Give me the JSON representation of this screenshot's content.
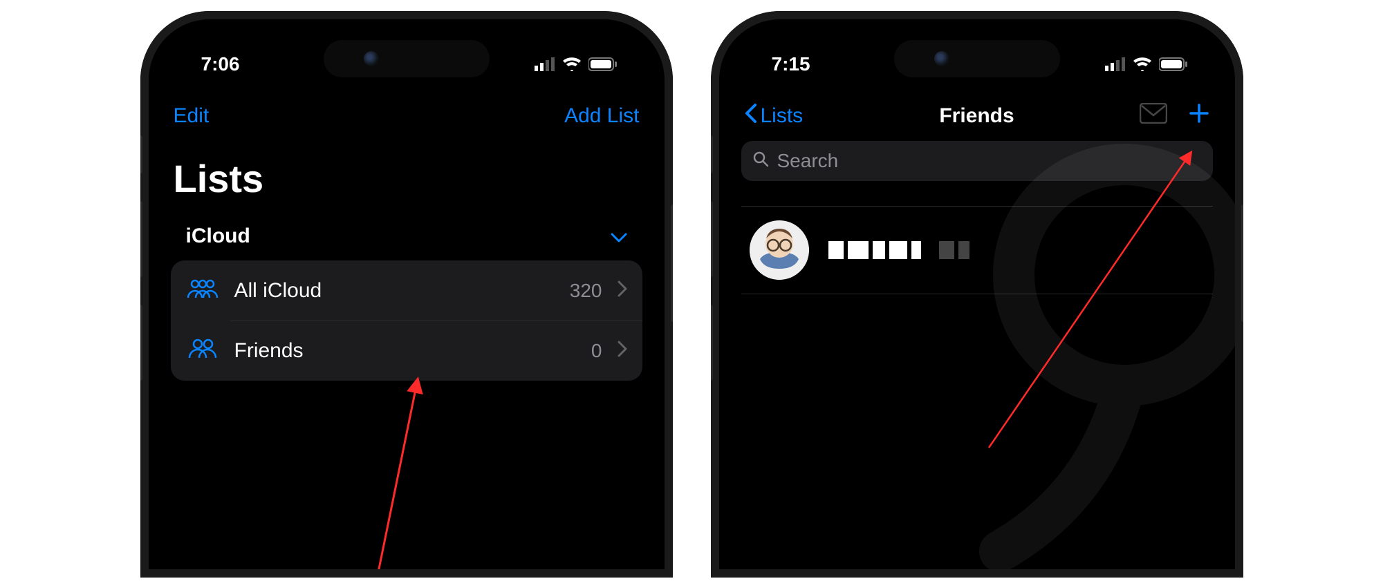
{
  "left_screen": {
    "status": {
      "time": "7:06"
    },
    "nav": {
      "edit": "Edit",
      "add_list": "Add List"
    },
    "large_title": "Lists",
    "section": {
      "title": "iCloud"
    },
    "rows": [
      {
        "icon": "people-3-icon",
        "label": "All iCloud",
        "count": "320"
      },
      {
        "icon": "people-2-icon",
        "label": "Friends",
        "count": "0"
      }
    ]
  },
  "right_screen": {
    "status": {
      "time": "7:15"
    },
    "nav": {
      "back_label": "Lists",
      "title": "Friends"
    },
    "search": {
      "placeholder": "Search"
    },
    "contact": {
      "name_redacted": true
    }
  },
  "colors": {
    "accent": "#0a84ff",
    "arrow": "#ff2a2a"
  }
}
